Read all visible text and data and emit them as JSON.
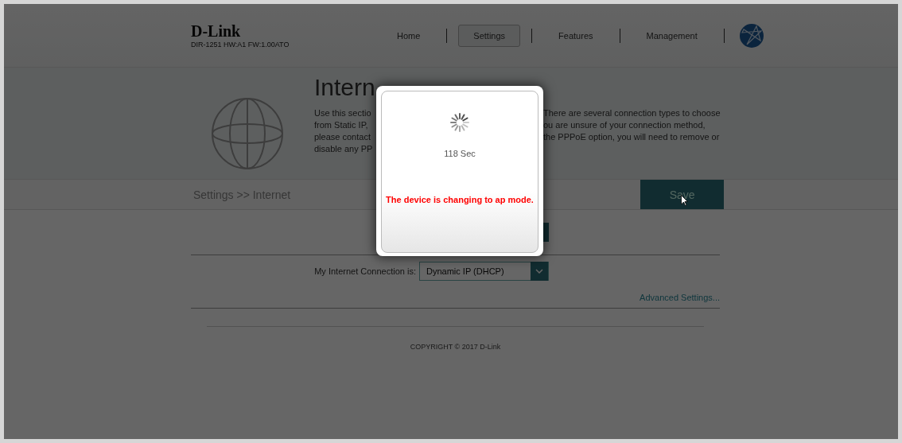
{
  "header": {
    "logo": "D-Link",
    "model": "DIR-1251 HW:A1 FW:1.00ATO",
    "nav": [
      {
        "label": "Home",
        "selected": false
      },
      {
        "label": "Settings",
        "selected": true
      },
      {
        "label": "Features",
        "selected": false
      },
      {
        "label": "Management",
        "selected": false
      }
    ]
  },
  "hero": {
    "title": "Intern",
    "description_left": [
      "Use this sectio",
      "from Static IP,",
      "please contact",
      "disable any PP"
    ],
    "description_right": [
      "There are several connection types to choose",
      "ou are unsure of your connection method,",
      "the PPPoE option, you will need to remove or"
    ]
  },
  "breadcrumb": "Settings >> Internet",
  "save_button": "Save",
  "connection": {
    "label": "My Internet Connection is:",
    "value": "Dynamic IP (DHCP)"
  },
  "advanced_link": "Advanced Settings...",
  "copyright": "COPYRIGHT © 2017 D-Link",
  "modal": {
    "countdown": "118 Sec",
    "message": "The device is changing to ap mode."
  }
}
